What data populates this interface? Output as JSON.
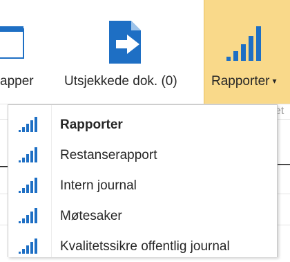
{
  "ribbon": {
    "mapper_label": "apper",
    "utsjekkede_label": "Utsjekkede dok. (0)",
    "rapporter_label": "Rapporter",
    "rapporter_caret": "▾",
    "background_header_text": "et"
  },
  "menu": {
    "items": [
      {
        "label": "Rapporter",
        "icon": "bar-chart-icon"
      },
      {
        "label": "Restanserapport",
        "icon": "bar-chart-icon"
      },
      {
        "label": "Intern journal",
        "icon": "bar-chart-icon"
      },
      {
        "label": "Møtesaker",
        "icon": "bar-chart-icon"
      },
      {
        "label": "Kvalitetssikre offentlig journal",
        "icon": "bar-chart-icon"
      }
    ]
  },
  "colors": {
    "accent_blue": "#1e6fc4",
    "rapporter_highlight": "#f9d98a"
  }
}
